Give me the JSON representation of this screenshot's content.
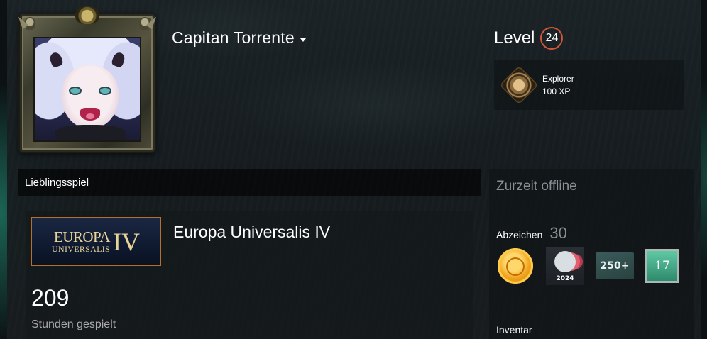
{
  "profile": {
    "persona_name": "Capitan Torrente",
    "level_label": "Level",
    "level": "24",
    "featured_badge": {
      "name": "Explorer",
      "xp": "100 XP",
      "icon": "explorer-badge-icon"
    }
  },
  "showcase": {
    "header": "Lieblingsspiel",
    "game": {
      "capsule_word_top": "EUROPA",
      "capsule_word_bottom": "UNIVERSALIS",
      "capsule_numeral": "IV",
      "title": "Europa Universalis IV",
      "hours": "209",
      "hours_label": "Stunden gespielt"
    }
  },
  "sidebar": {
    "status": "Zurzeit offline",
    "badges_label": "Abzeichen",
    "badges_count": "30",
    "badge_icons": [
      {
        "name": "gold-coin-badge-icon"
      },
      {
        "name": "steam-2024-badge-icon",
        "text": "2024"
      },
      {
        "name": "250-plus-badge-icon",
        "text": "250+"
      },
      {
        "name": "17-badge-icon",
        "text": "17"
      }
    ],
    "inventory_label": "Inventar"
  },
  "colors": {
    "level_ring": "#d0563a",
    "capsule_border": "#b4702d",
    "muted_text": "#8a8f93"
  }
}
